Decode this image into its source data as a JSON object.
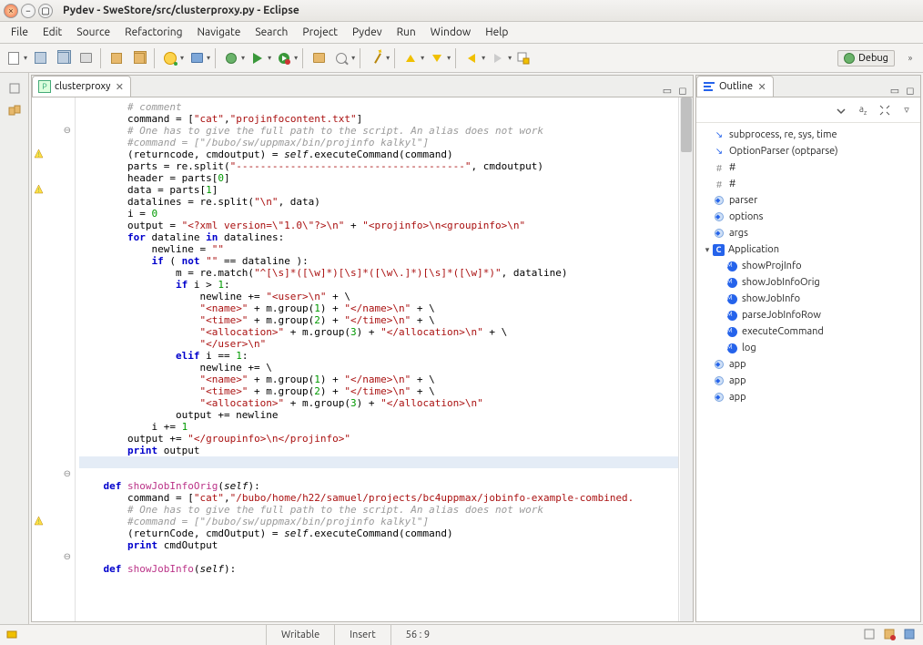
{
  "window": {
    "title": "Pydev - SweStore/src/clusterproxy.py - Eclipse"
  },
  "menu": {
    "file": "File",
    "edit": "Edit",
    "source": "Source",
    "refactoring": "Refactoring",
    "navigate": "Navigate",
    "search": "Search",
    "project": "Project",
    "pydev": "Pydev",
    "run": "Run",
    "window": "Window",
    "help": "Help"
  },
  "perspective": {
    "label": "Debug"
  },
  "editor": {
    "tab_label": "clusterproxy"
  },
  "outline": {
    "title": "Outline",
    "items": [
      {
        "icon": "import",
        "label": "subprocess, re, sys, time"
      },
      {
        "icon": "import",
        "label": "OptionParser (optparse)"
      },
      {
        "icon": "hash",
        "label": "#"
      },
      {
        "icon": "hash",
        "label": "#"
      },
      {
        "icon": "var",
        "label": "parser"
      },
      {
        "icon": "var",
        "label": "options"
      },
      {
        "icon": "var",
        "label": "args"
      },
      {
        "icon": "class",
        "label": "Application",
        "expanded": true,
        "children": [
          {
            "icon": "method",
            "label": "showProjInfo"
          },
          {
            "icon": "method",
            "label": "showJobInfoOrig"
          },
          {
            "icon": "method",
            "label": "showJobInfo"
          },
          {
            "icon": "method",
            "label": "parseJobInfoRow"
          },
          {
            "icon": "method",
            "label": "executeCommand"
          },
          {
            "icon": "method",
            "label": "log"
          }
        ]
      },
      {
        "icon": "var",
        "label": "app"
      },
      {
        "icon": "var",
        "label": "app"
      },
      {
        "icon": "var",
        "label": "app"
      }
    ]
  },
  "status": {
    "writable": "Writable",
    "insert": "Insert",
    "pos": "56 : 9"
  },
  "code": [
    {
      "g": "",
      "html": "        <span class='cmt'># comment</span>"
    },
    {
      "g": "",
      "html": "        command = [<span class='str'>\"cat\"</span>,<span class='str'>\"projinfocontent.txt\"</span>]"
    },
    {
      "g": "fold",
      "html": "        <span class='cmt'># One has to give the full path to the script. An alias does not work</span>"
    },
    {
      "g": "",
      "html": "        <span class='cmt'>#command = [\"/bubo/sw/uppmax/bin/projinfo kalkyl\"]</span>"
    },
    {
      "g": "warn",
      "html": "        (returncode, cmdoutput) = <span class='slf'>self</span>.executeCommand(command)"
    },
    {
      "g": "",
      "html": "        parts = re.split(<span class='str'>\"--------------------------------------\"</span>, cmdoutput)"
    },
    {
      "g": "",
      "html": "        header = parts[<span class='num'>0</span>]"
    },
    {
      "g": "warn",
      "html": "        data = parts[<span class='num'>1</span>]"
    },
    {
      "g": "",
      "html": "        datalines = re.split(<span class='str'>\"\\n\"</span>, data)"
    },
    {
      "g": "",
      "html": "        i = <span class='num'>0</span>"
    },
    {
      "g": "",
      "html": "        output = <span class='str'>\"&lt;?xml version=\\\"1.0\\\"?&gt;\\n\"</span> + <span class='str'>\"&lt;projinfo&gt;\\n&lt;groupinfo&gt;\\n\"</span>"
    },
    {
      "g": "",
      "html": "        <span class='kw'>for</span> dataline <span class='kw'>in</span> datalines:"
    },
    {
      "g": "",
      "html": "            newline = <span class='str'>\"\"</span>"
    },
    {
      "g": "",
      "html": "            <span class='kw'>if</span> ( <span class='kw'>not</span> <span class='str'>\"\"</span> == dataline ):"
    },
    {
      "g": "",
      "html": "                m = re.match(<span class='str'>\"^[\\s]*([\\w]*)[\\s]*([\\w\\.]*)[\\s]*([\\w]*)\"</span>, dataline)"
    },
    {
      "g": "",
      "html": "                <span class='kw'>if</span> i &gt; <span class='num'>1</span>:"
    },
    {
      "g": "",
      "html": "                    newline += <span class='str'>\"&lt;user&gt;\\n\"</span> + \\"
    },
    {
      "g": "",
      "html": "                    <span class='str'>\"&lt;name&gt;\"</span> + m.group(<span class='num'>1</span>) + <span class='str'>\"&lt;/name&gt;\\n\"</span> + \\"
    },
    {
      "g": "",
      "html": "                    <span class='str'>\"&lt;time&gt;\"</span> + m.group(<span class='num'>2</span>) + <span class='str'>\"&lt;/time&gt;\\n\"</span> + \\"
    },
    {
      "g": "",
      "html": "                    <span class='str'>\"&lt;allocation&gt;\"</span> + m.group(<span class='num'>3</span>) + <span class='str'>\"&lt;/allocation&gt;\\n\"</span> + \\"
    },
    {
      "g": "",
      "html": "                    <span class='str'>\"&lt;/user&gt;\\n\"</span>"
    },
    {
      "g": "",
      "html": "                <span class='kw'>elif</span> i == <span class='num'>1</span>:"
    },
    {
      "g": "",
      "html": "                    newline += \\"
    },
    {
      "g": "",
      "html": "                    <span class='str'>\"&lt;name&gt;\"</span> + m.group(<span class='num'>1</span>) + <span class='str'>\"&lt;/name&gt;\\n\"</span> + \\"
    },
    {
      "g": "",
      "html": "                    <span class='str'>\"&lt;time&gt;\"</span> + m.group(<span class='num'>2</span>) + <span class='str'>\"&lt;/time&gt;\\n\"</span> + \\"
    },
    {
      "g": "",
      "html": "                    <span class='str'>\"&lt;allocation&gt;\"</span> + m.group(<span class='num'>3</span>) + <span class='str'>\"&lt;/allocation&gt;\\n\"</span>"
    },
    {
      "g": "",
      "html": "                output += newline"
    },
    {
      "g": "",
      "html": "            i += <span class='num'>1</span>"
    },
    {
      "g": "",
      "html": "        output += <span class='str'>\"&lt;/groupinfo&gt;\\n&lt;/projinfo&gt;\"</span>"
    },
    {
      "g": "",
      "html": "        <span class='kw'>print</span> output"
    },
    {
      "g": "",
      "cls": "highlight-line",
      "html": "        "
    },
    {
      "g": "fold",
      "html": "    <span class='kw'>def</span> <span class='fn'>showJobInfoOrig</span>(<span class='slf'>self</span>):"
    },
    {
      "g": "",
      "html": "        command = [<span class='str'>\"cat\"</span>,<span class='str'>\"/bubo/home/h22/samuel/projects/bc4uppmax/jobinfo-example-combined.</span>"
    },
    {
      "g": "",
      "html": "        <span class='cmt'># One has to give the full path to the script. An alias does not work</span>"
    },
    {
      "g": "",
      "html": "        <span class='cmt'>#command = [\"/bubo/sw/uppmax/bin/projinfo kalkyl\"]</span>"
    },
    {
      "g": "warn",
      "html": "        (returnCode, cmdOutput) = <span class='slf'>self</span>.executeCommand(command)"
    },
    {
      "g": "",
      "html": "        <span class='kw'>print</span> cmdOutput"
    },
    {
      "g": "",
      "html": " "
    },
    {
      "g": "fold",
      "html": "    <span class='kw'>def</span> <span class='fn'>showJobInfo</span>(<span class='slf'>self</span>):"
    }
  ]
}
